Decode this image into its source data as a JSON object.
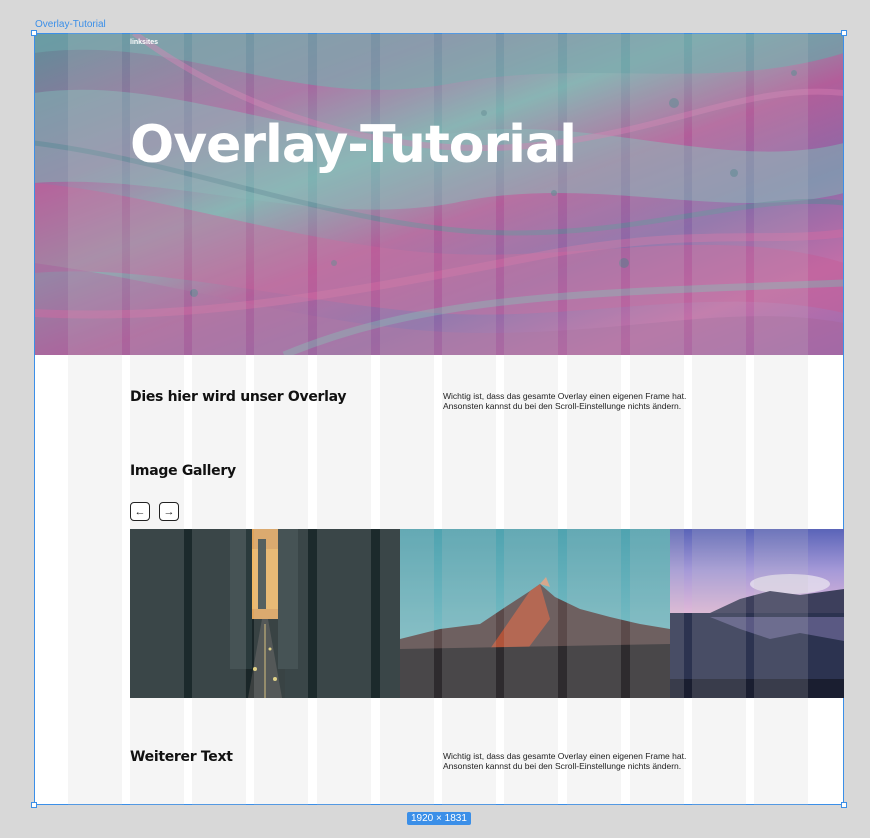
{
  "frame": {
    "label": "Overlay-Tutorial",
    "size_badge": "1920 × 1831"
  },
  "hero": {
    "brand": "linksites",
    "title": "Overlay-Tutorial"
  },
  "section1": {
    "heading": "Dies  hier wird unser Overlay",
    "text_line1": "Wichtig ist, dass das gesamte Overlay einen eigenen Frame hat.",
    "text_line2": "Ansonsten kannst du bei den Scroll-Einstellunge nichts ändern."
  },
  "gallery": {
    "heading": "Image Gallery",
    "prev_icon": "←",
    "next_icon": "→"
  },
  "section2": {
    "heading": "Weiterer Text",
    "text_line1": "Wichtig ist, dass das gesamte Overlay einen eigenen Frame hat.",
    "text_line2": "Ansonsten kannst du bei den Scroll-Einstellunge nichts ändern."
  },
  "colors": {
    "selection": "#3b8fe8",
    "text": "#111111"
  }
}
